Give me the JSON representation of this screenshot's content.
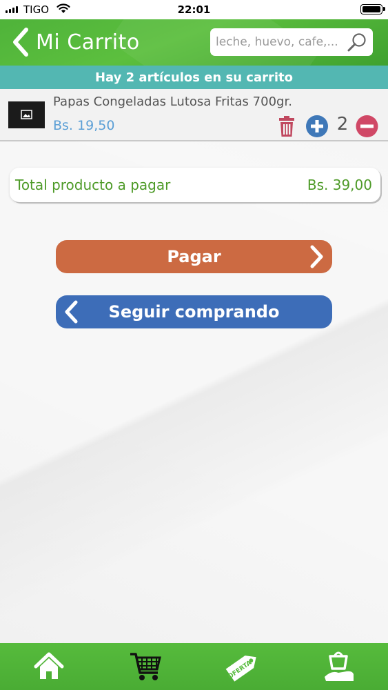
{
  "status_bar": {
    "carrier": "TIGO",
    "time": "22:01"
  },
  "header": {
    "title": "Mi Carrito",
    "search_placeholder": "leche, huevo, cafe,..."
  },
  "banner": {
    "text": "Hay 2 artículos en su carrito"
  },
  "cart_items": [
    {
      "name": "Papas Congeladas Lutosa Fritas 700gr.",
      "price": "Bs. 19,50",
      "quantity": "2"
    }
  ],
  "total": {
    "label": "Total producto a pagar",
    "value": "Bs. 39,00"
  },
  "buttons": {
    "pay": "Pagar",
    "continue": "Seguir comprando"
  },
  "tab_bar": {
    "items": [
      "home-icon",
      "cart-icon",
      "offer-tag-icon",
      "basket-hand-icon"
    ]
  },
  "colors": {
    "header_green": "#4fb33a",
    "banner_teal": "#53b7b2",
    "pay_orange": "#cc6a42",
    "continue_blue": "#3d6db8",
    "total_green": "#4d9a27",
    "price_blue": "#5b9fd6",
    "trash_red": "#c0485f",
    "plus_blue": "#3f78b8",
    "minus_red": "#d04866"
  }
}
